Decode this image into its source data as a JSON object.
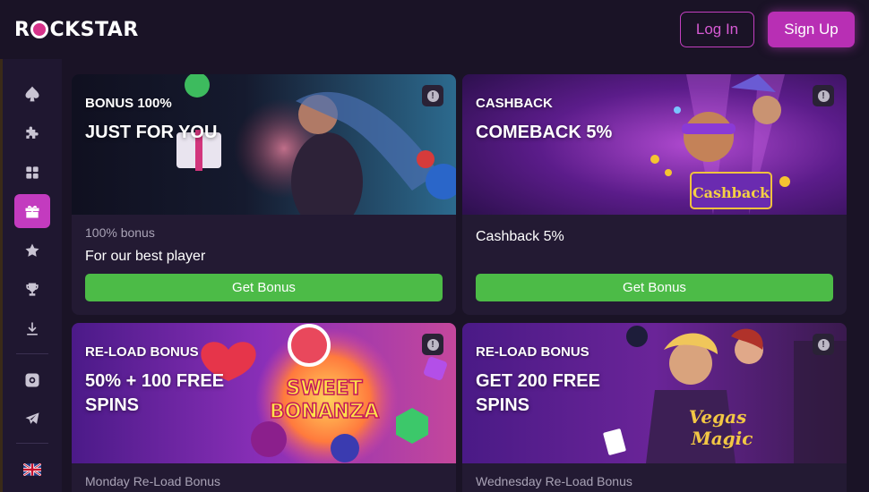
{
  "header": {
    "logo_prefix": "R",
    "logo_suffix": "CKSTAR",
    "login_label": "Log In",
    "signup_label": "Sign Up"
  },
  "sidebar": {
    "items": [
      {
        "icon": "spade-icon",
        "active": false
      },
      {
        "icon": "puzzle-icon",
        "active": false
      },
      {
        "icon": "grid-icon",
        "active": false
      },
      {
        "icon": "gift-icon",
        "active": true
      },
      {
        "icon": "star-icon",
        "active": false
      },
      {
        "icon": "trophy-icon",
        "active": false
      },
      {
        "icon": "download-icon",
        "active": false
      },
      {
        "icon": "instagram-icon",
        "active": false
      },
      {
        "icon": "telegram-icon",
        "active": false
      },
      {
        "icon": "uk-flag-icon",
        "active": false
      }
    ]
  },
  "cards": [
    {
      "kicker": "BONUS 100%",
      "title": "JUST FOR YOU",
      "subtitle": "100% bonus",
      "description": "For our best player",
      "button": "Get Bonus"
    },
    {
      "kicker": "CASHBACK",
      "title": "COMEBACK 5%",
      "description": "Cashback 5%",
      "button": "Get Bonus",
      "art_text": "Cashback"
    },
    {
      "kicker": "RE-LOAD BONUS",
      "title": "50% + 100 FREE SPINS",
      "subtitle": "Monday Re-Load Bonus",
      "art_text_1": "SWEET",
      "art_text_2": "BONANZA"
    },
    {
      "kicker": "RE-LOAD BONUS",
      "title": "GET 200 FREE SPINS",
      "subtitle": "Wednesday Re-Load Bonus",
      "art_text_1": "Vegas",
      "art_text_2": "Magic"
    }
  ],
  "colors": {
    "accent": "#c33bbf",
    "button_green": "#4cbb47",
    "background": "#1a1326"
  }
}
